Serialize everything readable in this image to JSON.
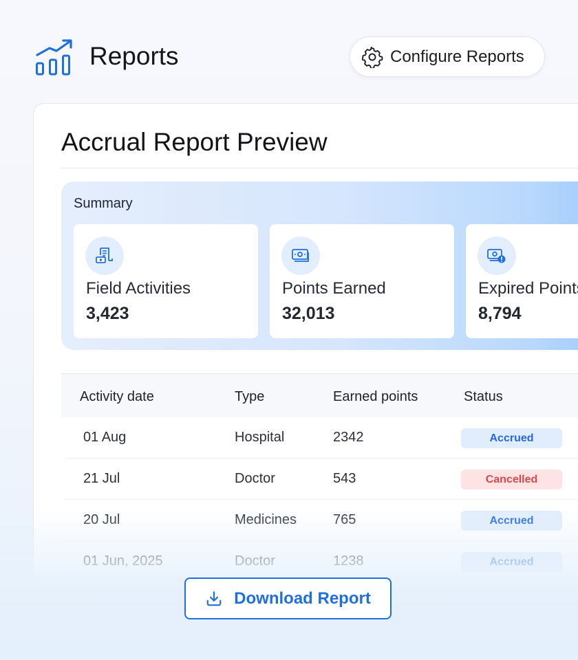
{
  "app": {
    "title": "Reports"
  },
  "header": {
    "configure_label": "Configure Reports"
  },
  "card": {
    "title": "Accrual Report Preview"
  },
  "summary": {
    "title": "Summary",
    "stats": [
      {
        "label": "Field Activities",
        "value": "3,423",
        "icon": "receipt-cash-icon"
      },
      {
        "label": "Points Earned",
        "value": "32,013",
        "icon": "banknote-icon"
      },
      {
        "label": "Expired Points",
        "value": "8,794",
        "icon": "banknote-alert-icon"
      }
    ]
  },
  "table": {
    "headers": [
      "Activity date",
      "Type",
      "Earned points",
      "Status"
    ],
    "rows": [
      {
        "date": "01 Aug",
        "type": "Hospital",
        "points": "2342",
        "status": "Accrued"
      },
      {
        "date": "21 Jul",
        "type": "Doctor",
        "points": "543",
        "status": "Cancelled"
      },
      {
        "date": "20 Jul",
        "type": "Medicines",
        "points": "765",
        "status": "Accrued"
      },
      {
        "date": "01 Jun, 2025",
        "type": "Doctor",
        "points": "1238",
        "status": "Accrued"
      }
    ]
  },
  "actions": {
    "download_label": "Download Report"
  },
  "colors": {
    "accent": "#1f6fdc",
    "accrued_bg": "#e1edfc",
    "accrued_text": "#2269dc",
    "cancelled_bg": "#fde3e3",
    "cancelled_text": "#d84a4a"
  }
}
